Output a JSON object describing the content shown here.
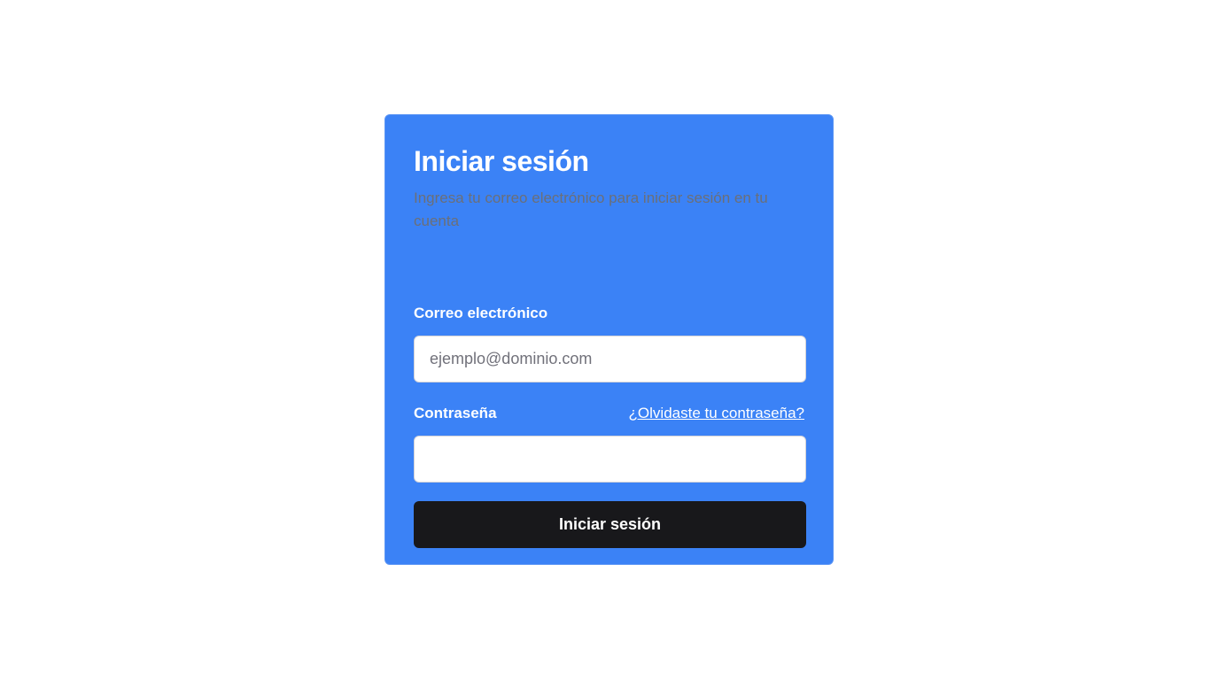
{
  "login": {
    "title": "Iniciar sesión",
    "subtitle": "Ingresa tu correo electrónico para iniciar sesión en tu cuenta",
    "email": {
      "label": "Correo electrónico",
      "placeholder": "ejemplo@dominio.com",
      "value": ""
    },
    "password": {
      "label": "Contraseña",
      "forgot_link": "¿Olvidaste tu contraseña?",
      "value": ""
    },
    "submit_label": "Iniciar sesión"
  },
  "colors": {
    "card_background": "#3b82f6",
    "button_background": "#18181b",
    "subtitle_text": "#6b6f78",
    "page_background": "#ffffff"
  }
}
